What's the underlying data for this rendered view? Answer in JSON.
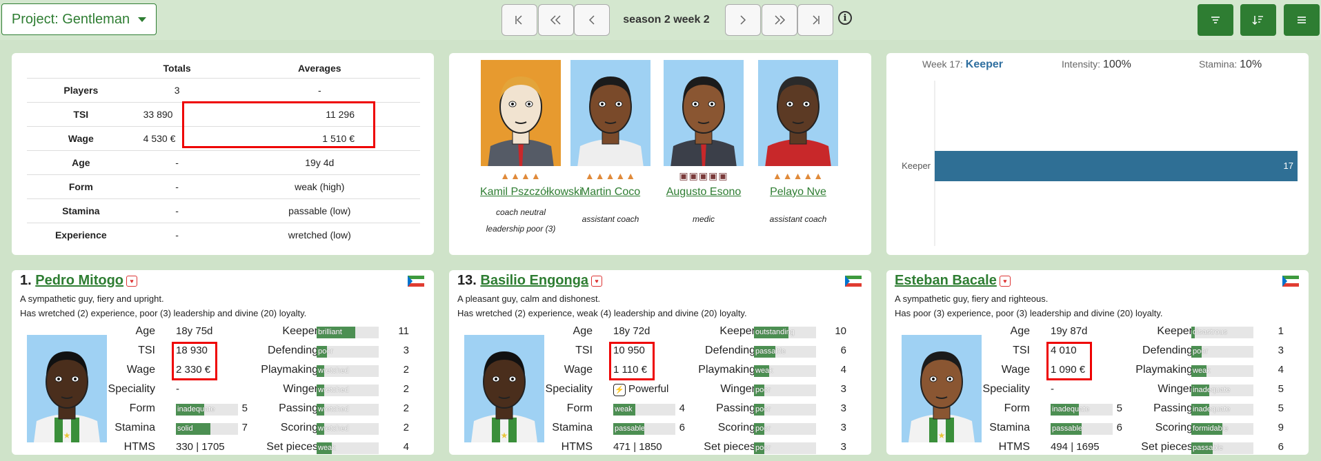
{
  "toolbar": {
    "project_label": "Project: Gentleman",
    "season": "season 2 week 2",
    "nav_first": "|‹",
    "nav_prev_many": "«",
    "nav_prev": "‹",
    "nav_next": "›",
    "nav_next_many": "»",
    "nav_last": "›|",
    "info": "i"
  },
  "summary": {
    "headers": [
      "",
      "Totals",
      "Averages"
    ],
    "rows": [
      {
        "label": "Players",
        "total": "3",
        "avg": "-"
      },
      {
        "label": "TSI",
        "total": "33 890",
        "avg": "11 296"
      },
      {
        "label": "Wage",
        "total": "4 530 €",
        "avg": "1 510 €"
      },
      {
        "label": "Age",
        "total": "-",
        "avg": "19y 4d"
      },
      {
        "label": "Form",
        "total": "-",
        "avg": "weak (high)"
      },
      {
        "label": "Stamina",
        "total": "-",
        "avg": "passable (low)"
      },
      {
        "label": "Experience",
        "total": "-",
        "avg": "wretched (low)"
      }
    ]
  },
  "staff": [
    {
      "name": "Kamil Pszczółkowski",
      "role_lines": [
        "coach neutral",
        "leadership poor (3)"
      ],
      "level": 4
    },
    {
      "name": "Martin Coco",
      "role_lines": [
        "assistant coach"
      ],
      "level": 5
    },
    {
      "name": "Augusto Esono",
      "role_lines": [
        "medic"
      ],
      "level": 5
    },
    {
      "name": "Pelayo Nve",
      "role_lines": [
        "assistant coach"
      ],
      "level": 5
    }
  ],
  "training": {
    "week_label": "Week 17:",
    "week_type": "Keeper",
    "intensity_label": "Intensity:",
    "intensity": "100%",
    "stamina_label": "Stamina:",
    "stamina": "10%",
    "chart_data": {
      "type": "bar",
      "categories": [
        "Keeper"
      ],
      "values": [
        17
      ],
      "xlim": [
        0,
        17
      ]
    }
  },
  "players": [
    {
      "number": "1.",
      "name": "Pedro Mitogo",
      "desc1": "A sympathetic guy, fiery and upright.",
      "desc2": "Has wretched (2) experience, poor (3) leadership and divine (20) loyalty.",
      "age": "18y 75d",
      "tsi": "18 930",
      "wage": "2 330 €",
      "speciality": "-",
      "form": {
        "text": "inadequate",
        "value": 5,
        "level": 0.45
      },
      "stamina": {
        "text": "solid",
        "value": 7,
        "level": 0.55
      },
      "htms": "330 | 1705",
      "skills": [
        {
          "name": "Keeper",
          "text": "brilliant",
          "value": 11,
          "level": 0.62
        },
        {
          "name": "Defending",
          "text": "poor",
          "value": 3,
          "level": 0.17
        },
        {
          "name": "Playmaking",
          "text": "wretched",
          "value": 2,
          "level": 0.12
        },
        {
          "name": "Winger",
          "text": "wretched",
          "value": 2,
          "level": 0.12
        },
        {
          "name": "Passing",
          "text": "wretched",
          "value": 2,
          "level": 0.12
        },
        {
          "name": "Scoring",
          "text": "wretched",
          "value": 2,
          "level": 0.12
        },
        {
          "name": "Set pieces",
          "text": "weak",
          "value": 4,
          "level": 0.24
        }
      ]
    },
    {
      "number": "13.",
      "name": "Basilio Engonga",
      "desc1": "A pleasant guy, calm and dishonest.",
      "desc2": "Has wretched (2) experience, weak (4) leadership and divine (20) loyalty.",
      "age": "18y 72d",
      "tsi": "10 950",
      "wage": "1 110 €",
      "speciality": "Powerful",
      "form": {
        "text": "weak",
        "value": 4,
        "level": 0.35
      },
      "stamina": {
        "text": "passable",
        "value": 6,
        "level": 0.5
      },
      "htms": "471 | 1850",
      "skills": [
        {
          "name": "Keeper",
          "text": "outstanding",
          "value": 10,
          "level": 0.56
        },
        {
          "name": "Defending",
          "text": "passable",
          "value": 6,
          "level": 0.34
        },
        {
          "name": "Playmaking",
          "text": "weak",
          "value": 4,
          "level": 0.24
        },
        {
          "name": "Winger",
          "text": "poor",
          "value": 3,
          "level": 0.17
        },
        {
          "name": "Passing",
          "text": "poor",
          "value": 3,
          "level": 0.17
        },
        {
          "name": "Scoring",
          "text": "poor",
          "value": 3,
          "level": 0.17
        },
        {
          "name": "Set pieces",
          "text": "poor",
          "value": 3,
          "level": 0.17
        }
      ]
    },
    {
      "number": "",
      "name": "Esteban Bacale",
      "desc1": "A sympathetic guy, fiery and righteous.",
      "desc2": "Has poor (3) experience, poor (3) leadership and divine (20) loyalty.",
      "age": "19y 87d",
      "tsi": "4 010",
      "wage": "1 090 €",
      "speciality": "-",
      "form": {
        "text": "inadequate",
        "value": 5,
        "level": 0.45
      },
      "stamina": {
        "text": "passable",
        "value": 6,
        "level": 0.5
      },
      "htms": "494 | 1695",
      "skills": [
        {
          "name": "Keeper",
          "text": "disastrous",
          "value": 1,
          "level": 0.06
        },
        {
          "name": "Defending",
          "text": "poor",
          "value": 3,
          "level": 0.17
        },
        {
          "name": "Playmaking",
          "text": "weak",
          "value": 4,
          "level": 0.24
        },
        {
          "name": "Winger",
          "text": "inadequate",
          "value": 5,
          "level": 0.29
        },
        {
          "name": "Passing",
          "text": "inadequate",
          "value": 5,
          "level": 0.29
        },
        {
          "name": "Scoring",
          "text": "formidable",
          "value": 9,
          "level": 0.5
        },
        {
          "name": "Set pieces",
          "text": "passable",
          "value": 6,
          "level": 0.34
        }
      ]
    }
  ],
  "labels": {
    "age": "Age",
    "tsi": "TSI",
    "wage": "Wage",
    "speciality": "Speciality",
    "form": "Form",
    "stamina": "Stamina",
    "htms": "HTMS"
  }
}
